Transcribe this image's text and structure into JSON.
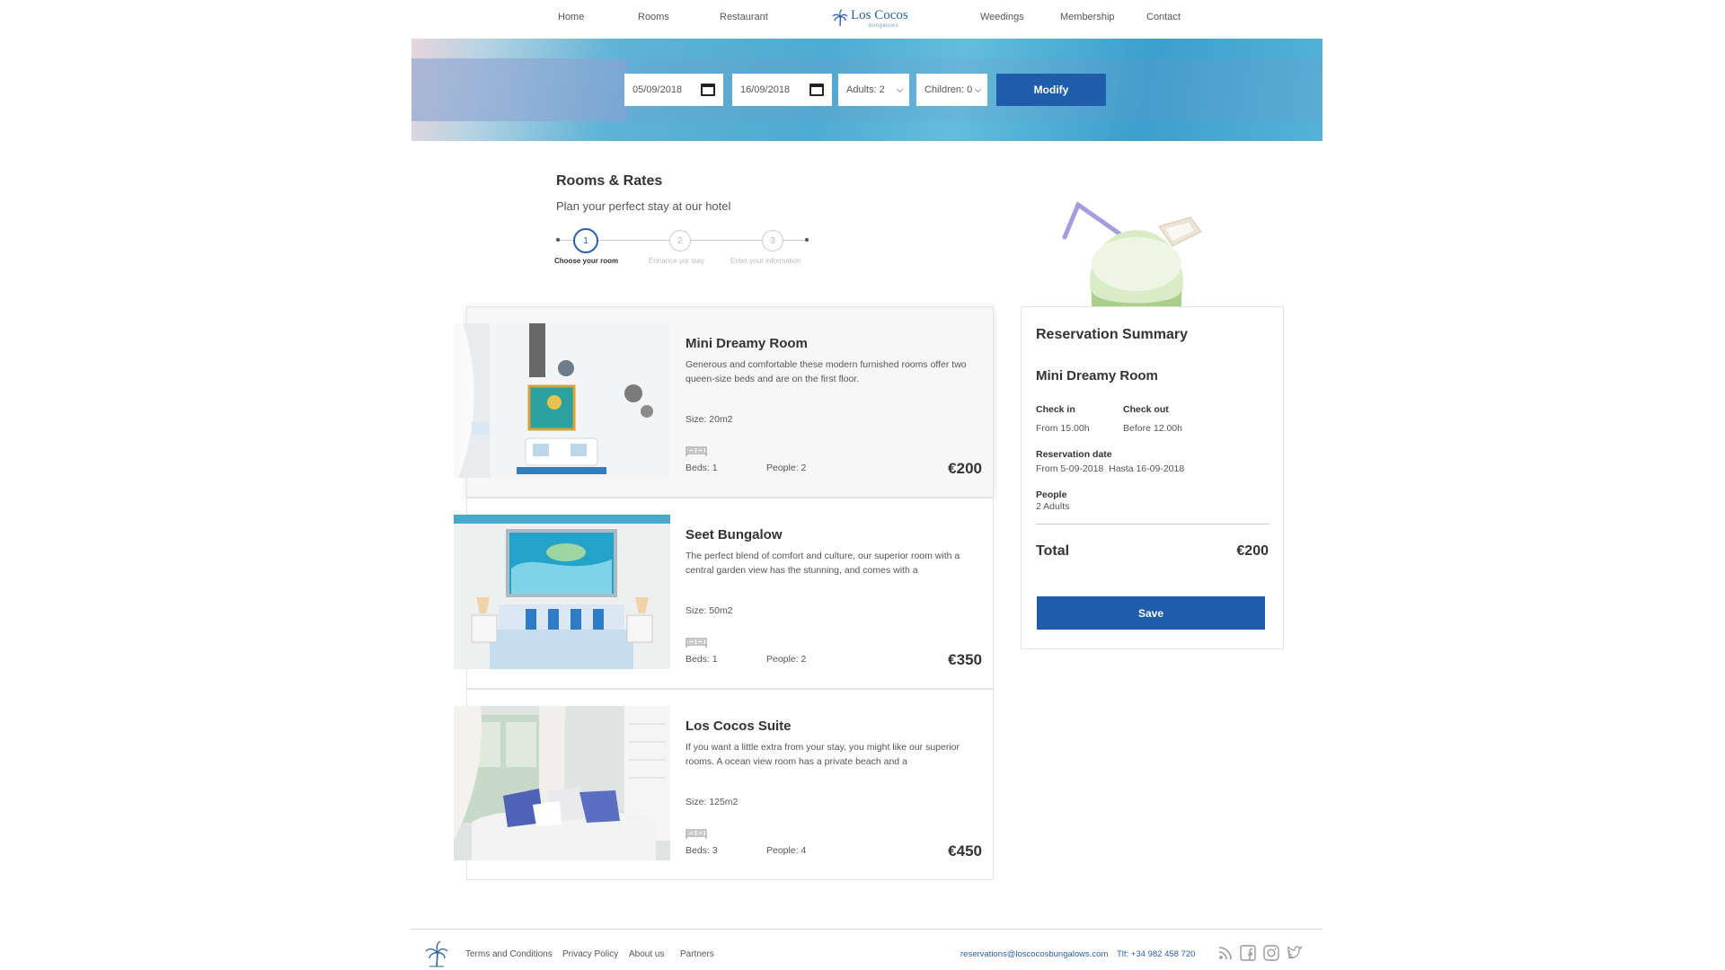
{
  "nav": {
    "items": [
      "Home",
      "Rooms",
      "Restaurant",
      "Weedings",
      "Membership",
      "Contact"
    ],
    "logo_text": "Los Cocos",
    "logo_sub": "bungalows"
  },
  "booking": {
    "checkin": "05/09/2018",
    "checkout": "16/09/2018",
    "adults": "Adults: 2",
    "children": "Children: 0",
    "modify_label": "Modify"
  },
  "page": {
    "title": "Rooms & Rates",
    "subtitle": "Plan your perfect stay at our hotel"
  },
  "steps": [
    {
      "number": "1",
      "label": "Choose your room",
      "active": true
    },
    {
      "number": "2",
      "label": "Enhance yor stay",
      "active": false
    },
    {
      "number": "3",
      "label": "Enter your information",
      "active": false
    }
  ],
  "rooms": [
    {
      "name": "Mini Dreamy Room",
      "description": "Generous and comfortable these modern furnished rooms offer two queen-size beds and are on the first floor.",
      "size": "Size: 20m2",
      "beds": "Beds: 1",
      "people": "People: 2",
      "price": "€200"
    },
    {
      "name": "Seet Bungalow",
      "description": "The perfect blend of comfort and culture, our superior room with a central garden view has the stunning, and comes with a",
      "size": "Size: 50m2",
      "beds": "Beds: 1",
      "people": "People: 2",
      "price": "€350"
    },
    {
      "name": "Los Cocos Suite",
      "description": "If you want a little extra from your stay, you might like our superior rooms. A ocean view room has a private beach and a",
      "size": "Size: 125m2",
      "beds": "Beds: 3",
      "people": "People: 4",
      "price": "€450"
    }
  ],
  "summary": {
    "title": "Reservation Summary",
    "room": "Mini Dreamy Room",
    "checkin_label": "Check in",
    "checkin_value": "From 15.00h",
    "checkout_label": "Check out",
    "checkout_value": "Before 12.00h",
    "date_label": "Reservation date",
    "date_value": "From 5-09-2018  Hasta 16-09-2018",
    "people_label": "People",
    "people_value": "2 Adults",
    "total_label": "Total",
    "total_value": "€200",
    "save_label": "Save"
  },
  "footer": {
    "links": [
      "Terms and Conditions",
      "Privacy Policy",
      "About us",
      "Partners"
    ],
    "email": "reservations@loscocosbungalows.com",
    "phone": "Tlf: +34 982 458 720",
    "social_icons": [
      "rss-icon",
      "facebook-icon",
      "instagram-icon",
      "twitter-icon"
    ]
  },
  "colors": {
    "accent": "#1f5ca9",
    "brand": "#2a5fa8"
  }
}
